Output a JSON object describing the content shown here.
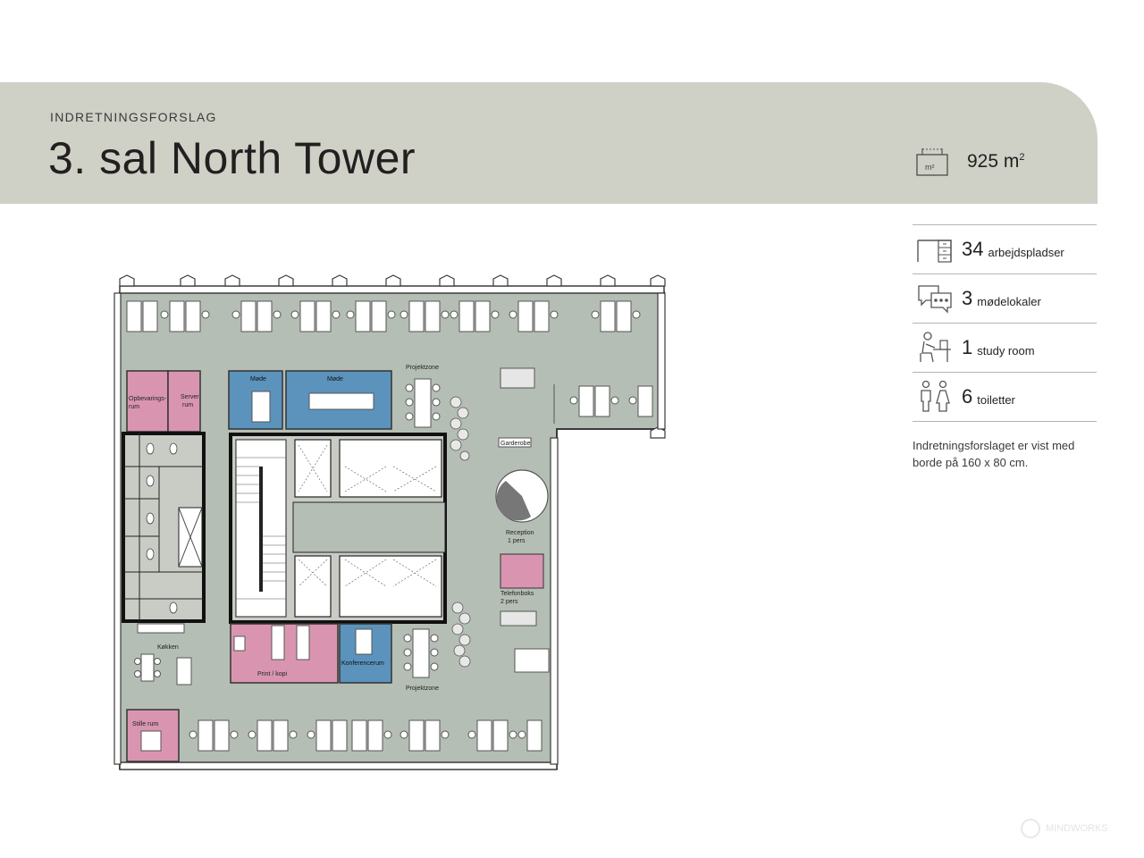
{
  "header": {
    "subtitle": "INDRETNINGSFORSLAG",
    "title": "3. sal North Tower"
  },
  "area": {
    "value": "925 m",
    "unit_sup": "2",
    "icon": "area-m2-icon"
  },
  "stats": [
    {
      "number": "34",
      "label": "arbejdspladser",
      "icon": "desk-icon"
    },
    {
      "number": "3",
      "label": "mødelokaler",
      "icon": "chat-bubbles-icon"
    },
    {
      "number": "1",
      "label": "study room",
      "icon": "study-person-icon"
    },
    {
      "number": "6",
      "label": "toiletter",
      "icon": "toilet-people-icon"
    }
  ],
  "note": "Indretningsforslaget er vist med borde på 160 x 80 cm.",
  "plan": {
    "labels": {
      "opbevaring": "Opbevarings-",
      "opbevaring2": "rum",
      "server": "Server",
      "server2": "rum",
      "mode1": "Møde",
      "mode2": "Møde",
      "projektzone_top": "Projektzone",
      "garderobe": "Garderobe",
      "reception": "Reception",
      "reception2": "1 pers",
      "telefonboks": "Telefonboks",
      "telefonboks2": "2 pers",
      "kokken": "Køkken",
      "print": "Print / kopi",
      "konferencerum": "Konferencerum",
      "projektzone_bottom": "Projektzone",
      "stille": "Stille rum"
    },
    "colors": {
      "floor": "#b5beb4",
      "blue": "#5b93bd",
      "pink": "#d995b0",
      "wall": "#1e1e1e"
    }
  },
  "watermark": "MINDWORKS"
}
